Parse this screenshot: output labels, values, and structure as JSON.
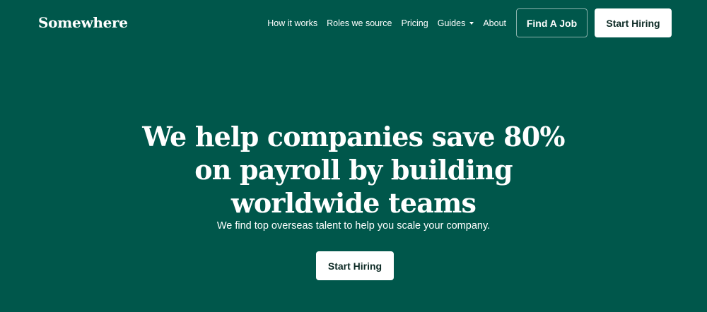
{
  "header": {
    "logo_text": "Somewhere",
    "nav": {
      "how_it_works": "How it works",
      "roles": "Roles we source",
      "pricing": "Pricing",
      "guides": "Guides",
      "about": "About"
    },
    "find_job_label": "Find A Job",
    "start_hiring_label": "Start Hiring"
  },
  "hero": {
    "title": "We help companies save 80% on payroll by building worldwide teams",
    "subtitle": "We find top overseas talent to help you scale your company.",
    "cta_label": "Start Hiring"
  },
  "colors": {
    "background": "#00574B",
    "text": "#FFFFFF",
    "button_bg": "#FFFFFF",
    "button_text": "#0D2A25"
  },
  "icons": {
    "guides_dropdown": "caret-down-icon"
  }
}
